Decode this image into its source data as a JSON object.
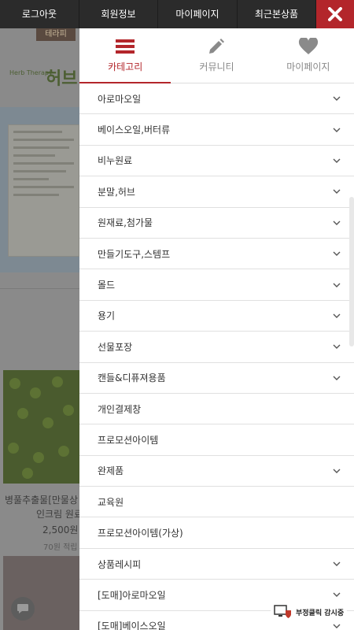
{
  "topbar": {
    "items": [
      {
        "label": "로그아웃"
      },
      {
        "label": "회원정보"
      },
      {
        "label": "마이페이지"
      },
      {
        "label": "최근본상품"
      }
    ]
  },
  "background": {
    "logo": "테라피",
    "brand_small": "Herb Therapy",
    "brand_big": "허브",
    "product": {
      "name_line1": "병풀추출물[만물상",
      "name_line2": "인크림 원료",
      "price": "2,500원",
      "point": "70원 적립"
    }
  },
  "panel": {
    "tabs": [
      {
        "label": "카테고리",
        "icon": "menu-icon",
        "active": true
      },
      {
        "label": "커뮤니티",
        "icon": "pencil-icon",
        "active": false
      },
      {
        "label": "마이페이지",
        "icon": "heart-icon",
        "active": false
      }
    ],
    "menu": [
      {
        "label": "아로마오일",
        "has_children": true
      },
      {
        "label": "베이스오일,버터류",
        "has_children": true
      },
      {
        "label": "비누원료",
        "has_children": true
      },
      {
        "label": "분말,허브",
        "has_children": true
      },
      {
        "label": "원재료,첨가물",
        "has_children": true
      },
      {
        "label": "만들기도구,스템프",
        "has_children": true
      },
      {
        "label": "몰드",
        "has_children": true
      },
      {
        "label": "용기",
        "has_children": true
      },
      {
        "label": "선물포장",
        "has_children": true
      },
      {
        "label": "캔들&디퓨져용품",
        "has_children": true
      },
      {
        "label": "개인결제창",
        "has_children": false
      },
      {
        "label": "프로모션아이템",
        "has_children": false
      },
      {
        "label": "완제품",
        "has_children": true
      },
      {
        "label": "교육원",
        "has_children": false
      },
      {
        "label": "프로모션아이템(가상)",
        "has_children": false
      },
      {
        "label": "상품레시피",
        "has_children": true
      },
      {
        "label": "[도매]아로마오일",
        "has_children": true
      },
      {
        "label": "[도매]베이스오일",
        "has_children": true
      }
    ]
  },
  "fraud_badge": {
    "label": "부정클릭 감시중"
  },
  "colors": {
    "accent": "#b3262b",
    "topbar": "#2b2b2b"
  }
}
